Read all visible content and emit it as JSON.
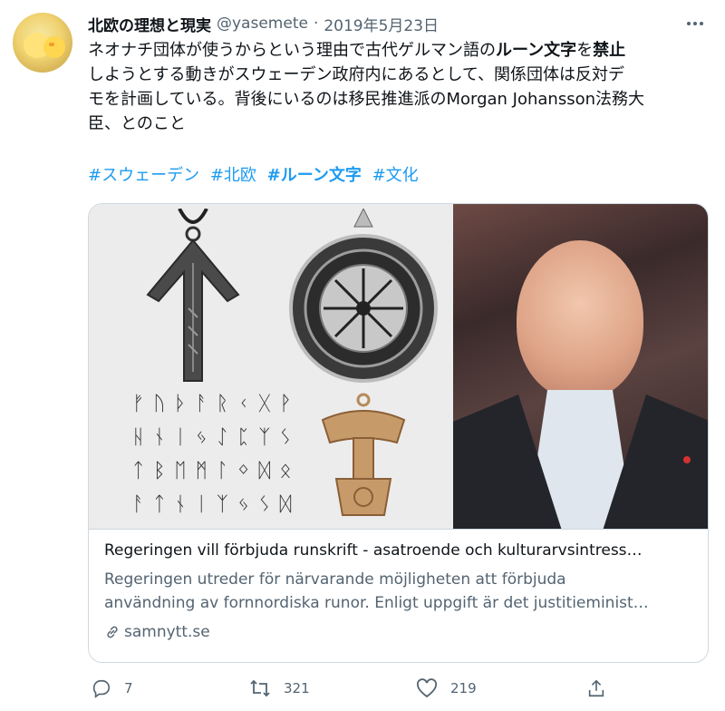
{
  "tweet": {
    "display_name": "北欧の理想と現実",
    "handle": "@yasemete",
    "separator": "·",
    "date": "2019年5月23日",
    "more_icon": "more-horizontal-icon",
    "body": {
      "seg1": "ネオナチ団体が使うからという理由で古代ゲルマン語の",
      "seg2_bold": "ルーン文字",
      "seg3": "を",
      "seg4_bold": "禁止",
      "line2": "しようとする動きがスウェーデン政府内にあるとして、関係団体は反対デ",
      "line3": "モを計画している。背後にいるのは移民推進派のMorgan Johansson法務大",
      "line4": "臣、とのこと"
    },
    "hashtags": [
      {
        "text": "#スウェーデン",
        "bold": false
      },
      {
        "text": "#北欧",
        "bold": false
      },
      {
        "text": "#ルーン文字",
        "bold": true
      },
      {
        "text": "#文化",
        "bold": false
      }
    ]
  },
  "card": {
    "title": "Regeringen vill förbjuda runskrift - asatroende och kulturarvsintress…",
    "desc_line1": "Regeringen utreder för närvarande möjligheten att förbjuda",
    "desc_line2": "användning av fornnordiska runor. Enligt uppgift är det justitieminist…",
    "domain": "samnytt.se",
    "rune_rows": [
      "ᚠᚢᚦᚨᚱᚲᚷᚹ",
      "ᚺᚾᛁᛃᛇᛈᛉᛊ",
      "ᛏᛒᛖᛗᛚᛜᛞᛟ",
      "ᚨᛏᚾᛁᛉᛃᛊᛞ"
    ]
  },
  "actions": {
    "reply_count": "7",
    "retweet_count": "321",
    "like_count": "219"
  },
  "colors": {
    "link": "#1d9bf0",
    "secondary_text": "#536471",
    "border": "#cfd9de"
  }
}
